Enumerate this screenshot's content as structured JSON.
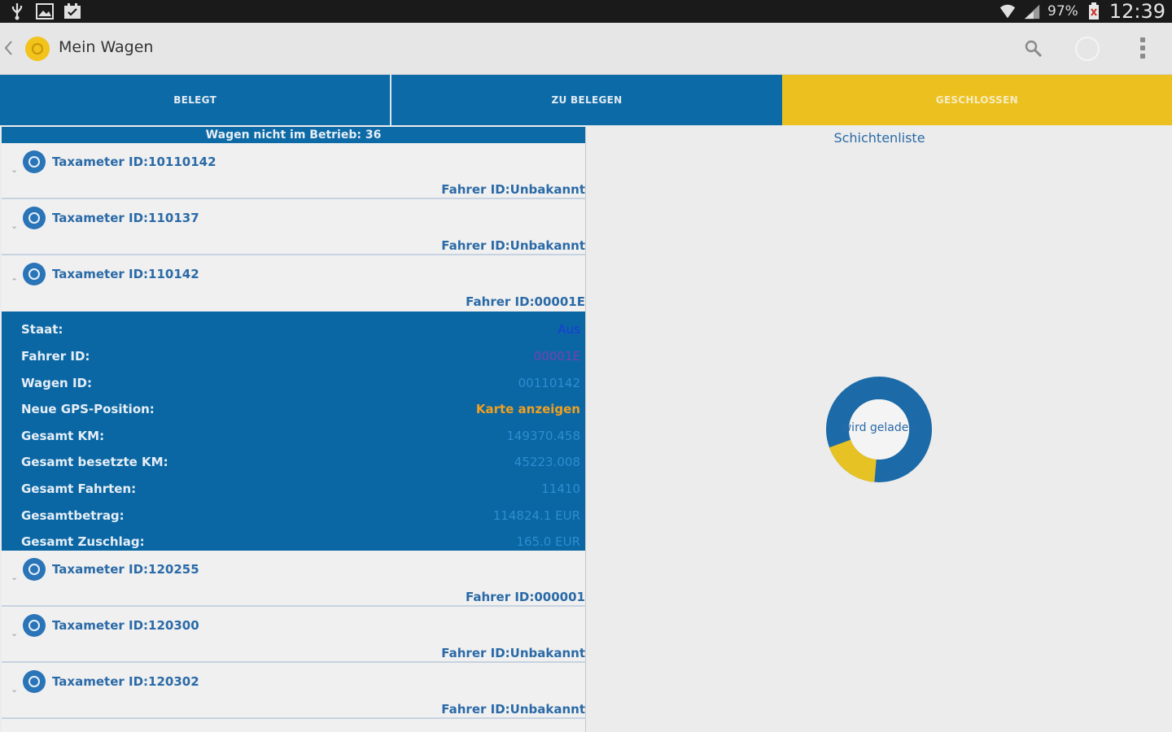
{
  "status_bar": {
    "battery": "97%",
    "time": "12:39"
  },
  "action_bar": {
    "title": "Mein Wagen"
  },
  "tabs": [
    {
      "label": "BELEGT"
    },
    {
      "label": "ZU BELEGEN"
    },
    {
      "label": "GESCHLOSSEN"
    }
  ],
  "left_panel": {
    "group_header": "Wagen nicht im Betrieb: 36",
    "items": [
      {
        "name": "Taxameter ID:10110142",
        "driver": "Fahrer ID:Unbakannt"
      },
      {
        "name": "Taxameter ID:110137",
        "driver": "Fahrer ID:Unbakannt"
      },
      {
        "name": "Taxameter ID:110142",
        "driver": "Fahrer ID:00001E"
      },
      {
        "name": "Taxameter ID:120255",
        "driver": "Fahrer ID:000001"
      },
      {
        "name": "Taxameter ID:120300",
        "driver": "Fahrer ID:Unbakannt"
      },
      {
        "name": "Taxameter ID:120302",
        "driver": "Fahrer ID:Unbakannt"
      }
    ],
    "details": [
      {
        "label": "Staat:",
        "value": "Aus",
        "color": "#1a3ad8"
      },
      {
        "label": "Fahrer ID:",
        "value": "00001E",
        "color": "#7a3fb0"
      },
      {
        "label": "Wagen ID:",
        "value": "00110142",
        "color": "#2f8cd0"
      },
      {
        "label": "Neue GPS-Position:",
        "value": "Karte anzeigen",
        "color": "#f0a020"
      },
      {
        "label": "Gesamt KM:",
        "value": "149370.458",
        "color": "#2f8cd0"
      },
      {
        "label": "Gesamt besetzte KM:",
        "value": "45223.008",
        "color": "#2f8cd0"
      },
      {
        "label": "Gesamt Fahrten:",
        "value": "11410",
        "color": "#2f8cd0"
      },
      {
        "label": "Gesamtbetrag:",
        "value": "114824.1 EUR",
        "color": "#2f8cd0"
      },
      {
        "label": "Gesamt Zuschlag:",
        "value": "165.0 EUR",
        "color": "#2f8cd0"
      }
    ]
  },
  "right_panel": {
    "title": "Schichtenliste",
    "loading_text": "wird geladen",
    "progress": 0.18
  },
  "colors": {
    "primary_blue": "#0c6aa6",
    "accent_yellow": "#ecc11f"
  }
}
